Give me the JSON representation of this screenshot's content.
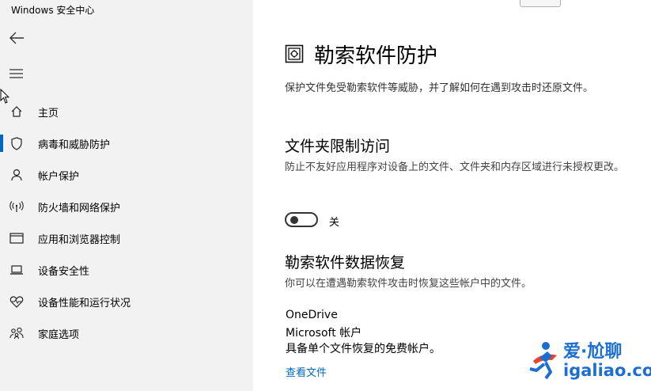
{
  "window": {
    "title": "Windows 安全中心"
  },
  "sidebar": {
    "items": [
      {
        "label": "主页",
        "icon": "home-icon"
      },
      {
        "label": "病毒和威胁防护",
        "icon": "shield-icon",
        "active": true
      },
      {
        "label": "帐户保护",
        "icon": "person-icon"
      },
      {
        "label": "防火墙和网络保护",
        "icon": "wireless-icon"
      },
      {
        "label": "应用和浏览器控制",
        "icon": "browser-window-icon"
      },
      {
        "label": "设备安全性",
        "icon": "laptop-icon"
      },
      {
        "label": "设备性能和运行状况",
        "icon": "heart-pulse-icon"
      },
      {
        "label": "家庭选项",
        "icon": "family-icon"
      }
    ]
  },
  "main": {
    "title": "勒索软件防护",
    "description": "保护文件免受勒索软件等威胁，并了解如何在遇到攻击时还原文件。",
    "folder_access": {
      "title": "文件夹限制访问",
      "description": "防止不友好应用程序对设备上的文件、文件夹和内存区域进行未授权更改。",
      "toggle_state": "关"
    },
    "recovery": {
      "title": "勒索软件数据恢复",
      "description": "你可以在遭遇勒索软件攻击时恢复这些帐户中的文件。",
      "provider": "OneDrive",
      "account": "Microsoft 帐户",
      "plan": "具备单个文件恢复的免费帐户。",
      "link": "查看文件"
    }
  },
  "watermark": {
    "cn": "爱·尬聊",
    "en": "igaliao.com"
  },
  "colors": {
    "accent": "#0067c0",
    "sidebar_bg": "#f2f2f2",
    "watermark": "#1c6fd0"
  }
}
